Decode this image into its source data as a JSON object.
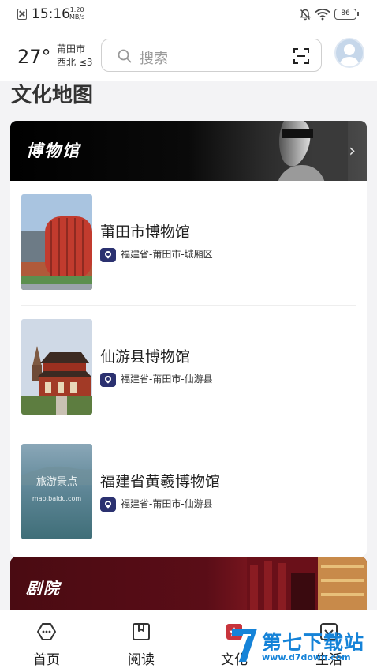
{
  "status_bar": {
    "time": "15:16",
    "speed_value": "1.20",
    "speed_unit": "MB/s",
    "battery": "86"
  },
  "header": {
    "temperature": "27°",
    "city": "莆田市",
    "wind": "西北 ≤3",
    "search_placeholder": "搜索"
  },
  "section_title": "文化地图",
  "museum_card": {
    "title": "博物馆",
    "items": [
      {
        "name": "莆田市博物馆",
        "address": "福建省-莆田市-城厢区"
      },
      {
        "name": "仙游县博物馆",
        "address": "福建省-莆田市-仙游县"
      },
      {
        "name": "福建省黄羲博物馆",
        "address": "福建省-莆田市-仙游县",
        "placeholder_caption": "旅游景点",
        "placeholder_url": "map.baidu.com"
      }
    ]
  },
  "theater_card": {
    "title": "剧院"
  },
  "tabs": [
    {
      "label": "首页",
      "icon": "home-icon"
    },
    {
      "label": "阅读",
      "icon": "book-icon"
    },
    {
      "label": "文化",
      "icon": "culture-icon"
    },
    {
      "label": "生活",
      "icon": "life-icon"
    }
  ],
  "watermark": {
    "text": "第七下载站",
    "url": "www.d7down.com"
  },
  "colors": {
    "pin": "#2b3170",
    "watermark": "#1583d8",
    "theater": "#5a0d17"
  }
}
